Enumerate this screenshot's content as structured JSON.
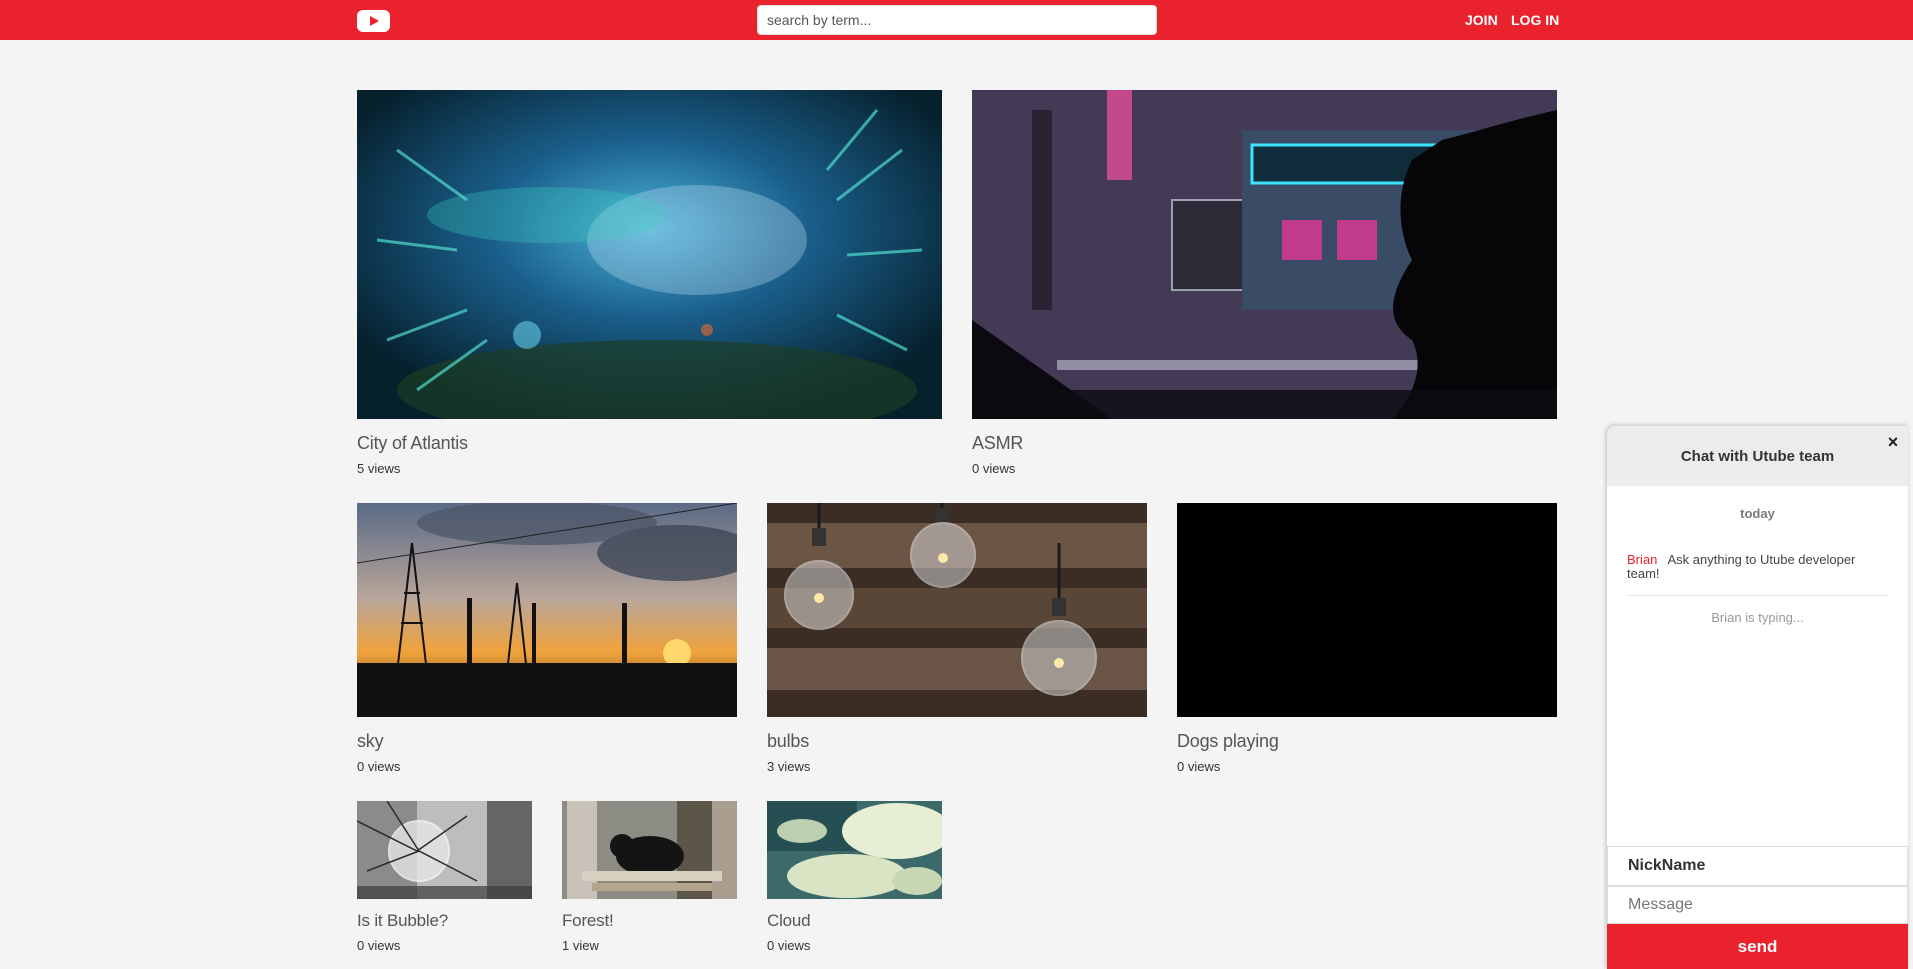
{
  "header": {
    "logo_icon": "play-logo-icon",
    "search_placeholder": "search by term...",
    "join_label": "JOIN",
    "login_label": "LOG IN",
    "brand_color": "#ea222e"
  },
  "videos": [
    {
      "title": "City of Atlantis",
      "views": "5 views"
    },
    {
      "title": "ASMR",
      "views": "0 views"
    },
    {
      "title": "sky",
      "views": "0 views"
    },
    {
      "title": "bulbs",
      "views": "3 views"
    },
    {
      "title": "Dogs playing",
      "views": "0 views"
    },
    {
      "title": "Is it Bubble?",
      "views": "0 views"
    },
    {
      "title": "Forest!",
      "views": "1 view"
    },
    {
      "title": "Cloud",
      "views": "0 views"
    }
  ],
  "chat": {
    "title": "Chat with Utube team",
    "close_label": "×",
    "date_label": "today",
    "message": {
      "name": "Brian",
      "text": "Ask anything to Utube developer team!"
    },
    "typing": "Brian is typing...",
    "nickname_placeholder": "NickName",
    "message_placeholder": "Message",
    "send_label": "send"
  }
}
